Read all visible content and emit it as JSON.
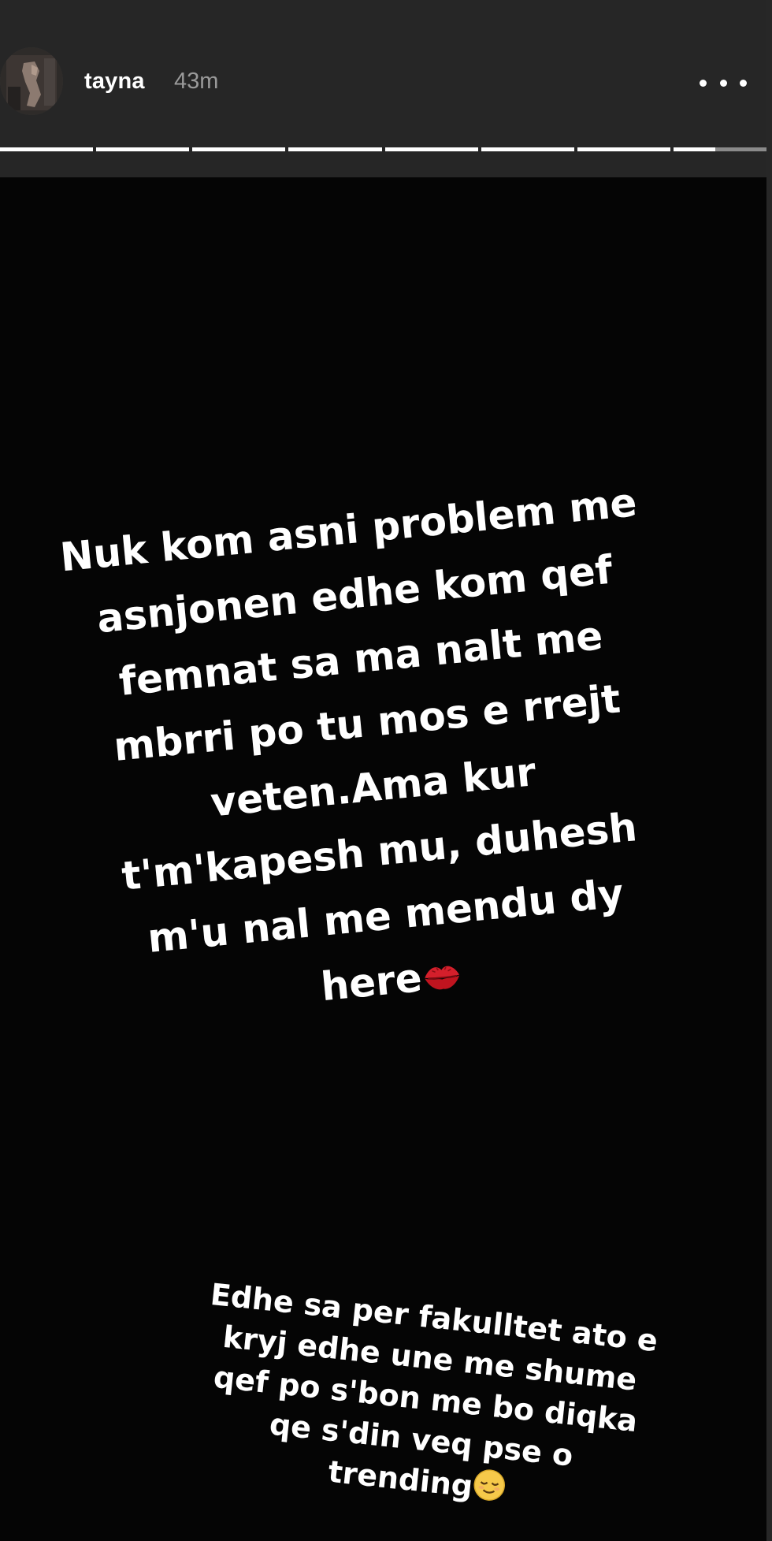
{
  "header": {
    "username": "tayna",
    "time": "43m",
    "avatar_icon": "profile-avatar",
    "more_icon": "more-horizontal-icon"
  },
  "progress": {
    "total_segments": 8,
    "completed_segments": 7,
    "current_segment_progress": 0.45,
    "active_color": "#ffffff",
    "inactive_color": "#8a8a8a"
  },
  "story": {
    "background_color": "#050505",
    "text_blocks": [
      {
        "text": "Nuk kom asni problem me\nasnjonen edhe kom qef\nfemnat sa ma nalt me\nmbrri po tu mos e rrejt\nveten.Ama kur\nt'm'kapesh mu, duhesh\nm'u nal me mendu dy\nhere",
        "emoji": "kiss-mark-icon"
      },
      {
        "text": "Edhe sa per fakulltet ato e\nkryj edhe une me shume\nqef po s'bon me bo diqka\nqe s'din veq pse o\ntrending",
        "emoji": "relieved-face-icon"
      }
    ]
  }
}
